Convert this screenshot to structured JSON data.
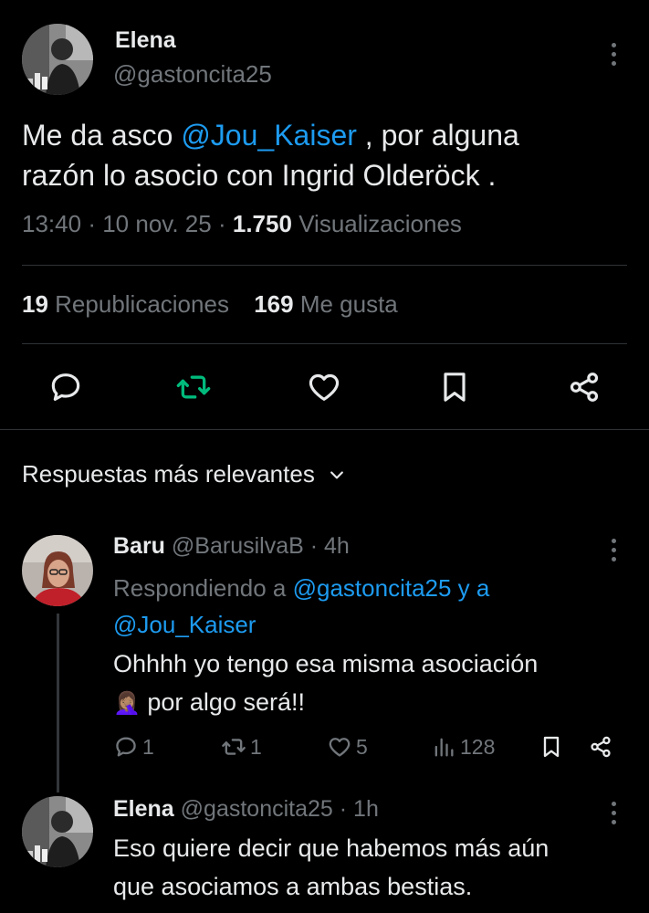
{
  "tweet": {
    "author_name": "Elena",
    "author_handle": "@gastoncita25",
    "text_part1": "Me da asco ",
    "mention": "@Jou_Kaiser",
    "text_part2": " , por alguna",
    "text_line2": "razón lo asocio con Ingrid Olderöck .",
    "time": "13:40",
    "sep1": "·",
    "date": "10 nov. 25",
    "sep2": "·",
    "views_count": "1.750",
    "views_label": "Visualizaciones",
    "reposts_count": "19",
    "reposts_label": "Republicaciones",
    "likes_count": "169",
    "likes_label": "Me gusta"
  },
  "replies_header": {
    "label": "Respuestas más relevantes"
  },
  "replies": [
    {
      "author_name": "Baru",
      "author_handle": "@BarusilvaB",
      "dot": "·",
      "time": "4h",
      "replying_label": "Respondiendo a ",
      "replying_to1": "@gastoncita25 y a",
      "replying_to2": "@Jou_Kaiser",
      "text_line1": "Ohhhh yo tengo esa misma asociación",
      "emoji": "🤦🏽‍♀️",
      "text_line2": " por algo será!!",
      "replies_count": "1",
      "reposts_count": "1",
      "likes_count": "5",
      "views_count": "128"
    },
    {
      "author_name": "Elena",
      "author_handle": "@gastoncita25",
      "dot": "·",
      "time": "1h",
      "text_line1": "Eso quiere decir que habemos más aún",
      "text_line2": "que asociamos a ambas bestias."
    }
  ],
  "colors": {
    "background": "#000000",
    "text": "#e7e9ea",
    "muted": "#71767b",
    "link": "#1d9bf0",
    "repost_active": "#00ba7c",
    "divider": "#2f3336"
  },
  "icons": {
    "reply": "reply-icon",
    "repost": "repost-icon",
    "like": "heart-icon",
    "bookmark": "bookmark-icon",
    "share": "share-icon",
    "views": "views-icon",
    "more": "more-icon",
    "chevron": "chevron-down-icon"
  }
}
